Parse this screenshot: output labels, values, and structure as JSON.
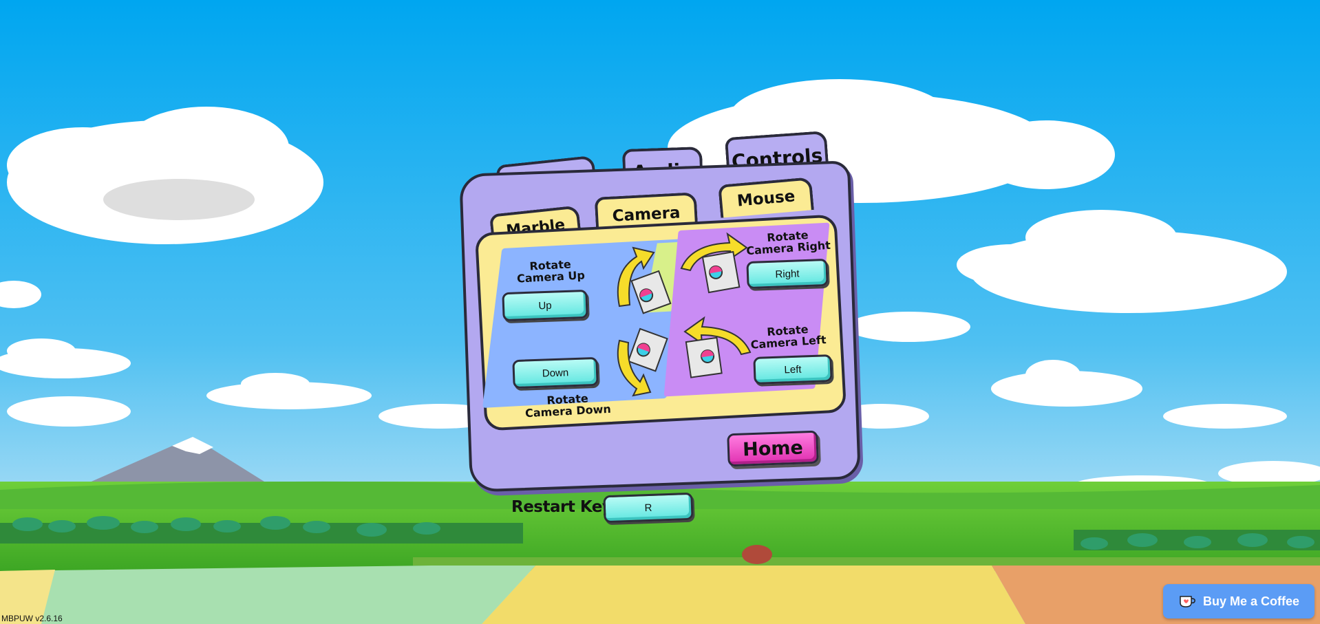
{
  "main_tabs": [
    {
      "label": "Graphics"
    },
    {
      "label": "Audio"
    },
    {
      "label": "Controls"
    }
  ],
  "sub_tabs": [
    {
      "label": "Marble"
    },
    {
      "label": "Camera"
    },
    {
      "label": "Mouse"
    }
  ],
  "active_main_tab": "Controls",
  "active_sub_tab": "Camera",
  "camera": {
    "rotate_up_label_1": "Rotate",
    "rotate_up_label_2": "Camera Up",
    "rotate_up_key": "Up",
    "rotate_down_label_1": "Rotate",
    "rotate_down_label_2": "Camera Down",
    "rotate_down_key": "Down",
    "rotate_right_label_1": "Rotate",
    "rotate_right_label_2": "Camera Right",
    "rotate_right_key": "Right",
    "rotate_left_label_1": "Rotate",
    "rotate_left_label_2": "Camera Left",
    "rotate_left_key": "Left"
  },
  "home_button": "Home",
  "restart": {
    "label": "Restart Key",
    "key": "R"
  },
  "version": "MBPUW v2.6.16",
  "coffee_button": "Buy Me a Coffee",
  "colors": {
    "sky_top": "#00a8f0",
    "sky_bottom": "#7cd0f4",
    "panel_purple": "#b3a8f0",
    "panel_yellow": "#fbeb94",
    "blue_area": "#8cb4ff",
    "purple_area": "#c98cf4",
    "key_button": "#74ece6",
    "home_button": "#f050c8",
    "coffee": "#5b9cf5"
  }
}
